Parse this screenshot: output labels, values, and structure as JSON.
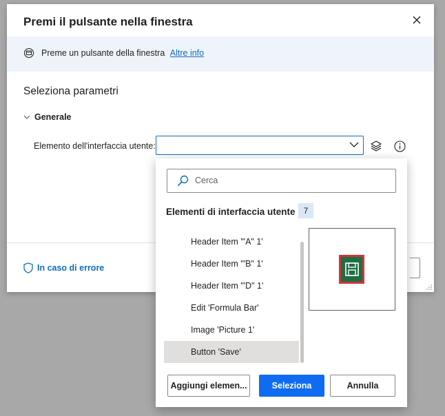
{
  "dialog": {
    "title": "Premi il pulsante nella finestra",
    "info_text": "Preme un pulsante della finestra",
    "info_link": "Altre info",
    "section_title": "Seleziona parametri",
    "group_label": "Generale",
    "field_label": "Elemento dell'interfaccia utente:",
    "field_value": "",
    "error_link": "In caso di errore"
  },
  "picker": {
    "search_placeholder": "Cerca",
    "list_title": "Elementi di interfaccia utente",
    "count": "7",
    "items": [
      {
        "label": "Header Item '\"A\" 1'"
      },
      {
        "label": "Header Item '\"B\" 1'"
      },
      {
        "label": "Header Item '\"D\" 1'"
      },
      {
        "label": "Edit 'Formula Bar'"
      },
      {
        "label": "Image 'Picture 1'"
      },
      {
        "label": "Button 'Save'"
      }
    ],
    "selected_item": "Button 'Save'",
    "buttons": {
      "add": "Aggiungi elemen...",
      "select": "Seleziona",
      "cancel": "Annulla"
    }
  },
  "colors": {
    "accent": "#0f6cbd",
    "primary_button": "#0f6cf0",
    "info_bar": "#eff4fb",
    "preview_fill": "#1f6e43",
    "preview_highlight": "#d13438"
  }
}
